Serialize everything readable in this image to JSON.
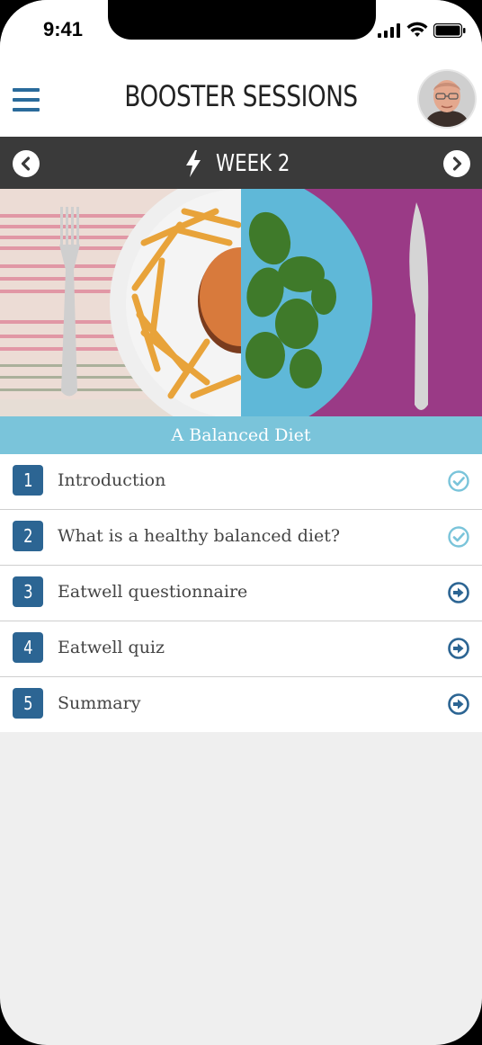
{
  "status": {
    "time": "9:41"
  },
  "header": {
    "title": "BOOSTER SESSIONS"
  },
  "week": {
    "label": "WEEK 2"
  },
  "topic": {
    "title": "A Balanced Diet"
  },
  "sessions": [
    {
      "number": "1",
      "label": "Introduction",
      "status": "completed"
    },
    {
      "number": "2",
      "label": "What is a healthy balanced diet?",
      "status": "completed"
    },
    {
      "number": "3",
      "label": "Eatwell questionnaire",
      "status": "go"
    },
    {
      "number": "4",
      "label": "Eatwell quiz",
      "status": "go"
    },
    {
      "number": "5",
      "label": "Summary",
      "status": "go"
    }
  ],
  "colors": {
    "accent": "#2c6593",
    "topic_bar": "#7ac4da",
    "week_bar": "#3a3a3a",
    "completed_icon": "#7ac4da",
    "go_icon": "#2c6593"
  }
}
